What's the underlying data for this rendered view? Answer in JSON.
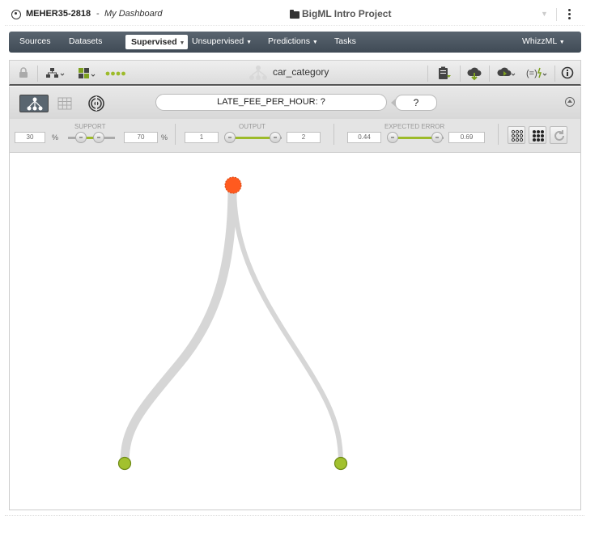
{
  "user": {
    "name": "MEHER35-2818",
    "separator": " - ",
    "dashboard_link": "My Dashboard"
  },
  "project": {
    "name": "BigML Intro Project"
  },
  "nav": {
    "sources": "Sources",
    "datasets": "Datasets",
    "supervised": "Supervised",
    "unsupervised": "Unsupervised",
    "predictions": "Predictions",
    "tasks": "Tasks",
    "whizzml": "WhizzML"
  },
  "toolbar": {
    "model_name": "car_category"
  },
  "prediction": {
    "field_label": "LATE_FEE_PER_HOUR: ?",
    "result": "?"
  },
  "filters": {
    "support": {
      "label": "SUPPORT",
      "min": "30",
      "max": "70",
      "unit": "%"
    },
    "output": {
      "label": "OUTPUT",
      "min": "1",
      "max": "2"
    },
    "expected_error": {
      "label": "EXPECTED ERROR",
      "min": "0.44",
      "max": "0.69"
    }
  },
  "colors": {
    "root_node": "#ff5a1f",
    "leaf_node": "#a2c12e",
    "branch": "#d6d6d6",
    "slider_fill": "#9dbb2a",
    "nav_bg": "#4a5560"
  },
  "tree": {
    "nodes": 3,
    "leaves": 2
  }
}
